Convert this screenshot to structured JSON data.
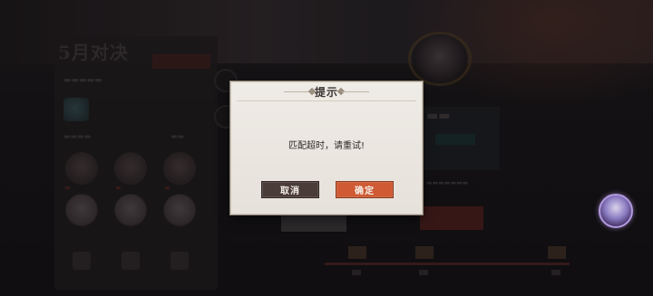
{
  "background": {
    "event_title": "5月对决"
  },
  "dialog": {
    "title": "提示",
    "message": "匹配超时，请重试!",
    "cancel_label": "取消",
    "confirm_label": "确定"
  },
  "colors": {
    "dialog_bg": "#ebe6e0",
    "cancel_button": "#4a3c38",
    "confirm_button": "#cf5a33",
    "overlay": "#0e0d0e"
  },
  "icons": [
    "character-avatar-icon",
    "emblem-icon"
  ]
}
